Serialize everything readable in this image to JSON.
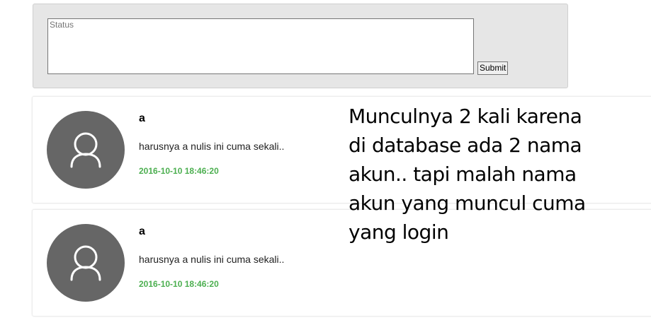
{
  "status_form": {
    "placeholder": "Status",
    "submit_label": "Submit"
  },
  "posts": [
    {
      "author": "a",
      "body": "harusnya a nulis ini cuma sekali..",
      "timestamp": "2016-10-10 18:46:20",
      "avatar_icon": "user-avatar-icon"
    },
    {
      "author": "a",
      "body": "harusnya a nulis ini cuma sekali..",
      "timestamp": "2016-10-10 18:46:20",
      "avatar_icon": "user-avatar-icon"
    }
  ],
  "annotation": {
    "text": "Munculnya 2 kali karena\ndi database ada 2 nama\nakun.. tapi malah nama\nakun yang muncul cuma\nyang login"
  },
  "colors": {
    "timestamp": "#4caf50",
    "avatar_bg": "#666666",
    "panel_bg": "#e6e6e6"
  }
}
